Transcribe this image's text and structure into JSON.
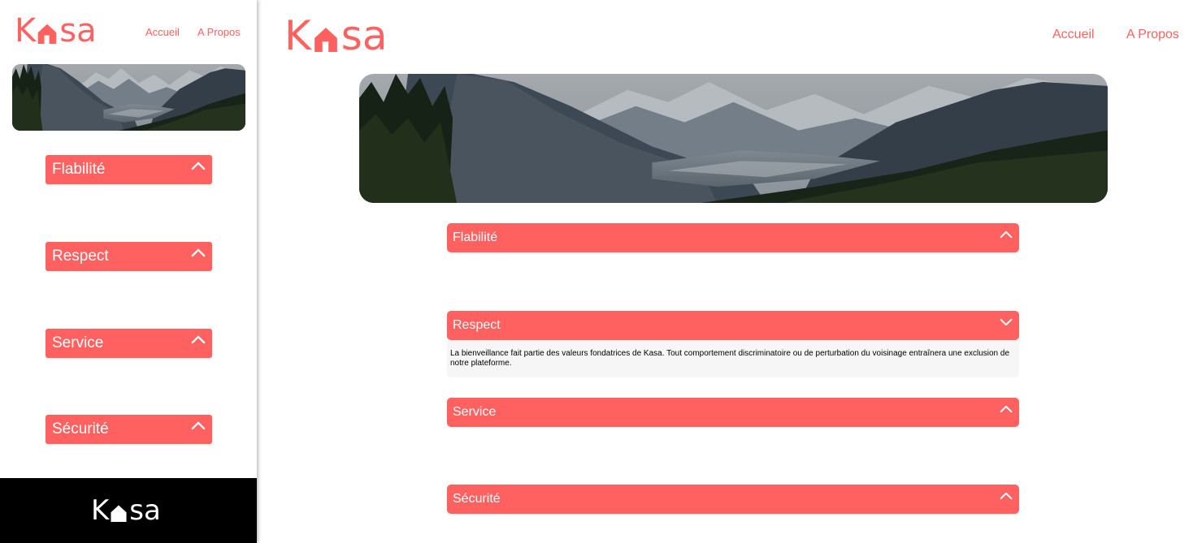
{
  "brand": {
    "logo_first": "K",
    "logo_rest": "sa",
    "color_primary": "#FF6060",
    "color_body_bg": "#F6F6F6",
    "color_footer": "#000000"
  },
  "nav": {
    "home_label": "Accueil",
    "about_label": "A Propos"
  },
  "banner": {
    "icon": "mountain-landscape-image"
  },
  "mobile": {
    "sections": [
      {
        "title": "Flabilité",
        "icon": "chevron-up-icon"
      },
      {
        "title": "Respect",
        "icon": "chevron-up-icon"
      },
      {
        "title": "Service",
        "icon": "chevron-up-icon"
      },
      {
        "title": "Sécurité",
        "icon": "chevron-up-icon"
      }
    ]
  },
  "desktop": {
    "sections": [
      {
        "title": "Flabilité",
        "icon": "chevron-up-icon",
        "open": false
      },
      {
        "title": "Respect",
        "icon": "chevron-down-icon",
        "open": true,
        "text": "La bienveillance fait partie des valeurs fondatrices de Kasa. Tout comportement discriminatoire ou de perturbation du voisinage entraînera une exclusion de notre plateforme."
      },
      {
        "title": "Service",
        "icon": "chevron-up-icon",
        "open": false
      },
      {
        "title": "Sécurité",
        "icon": "chevron-up-icon",
        "open": false
      }
    ]
  }
}
